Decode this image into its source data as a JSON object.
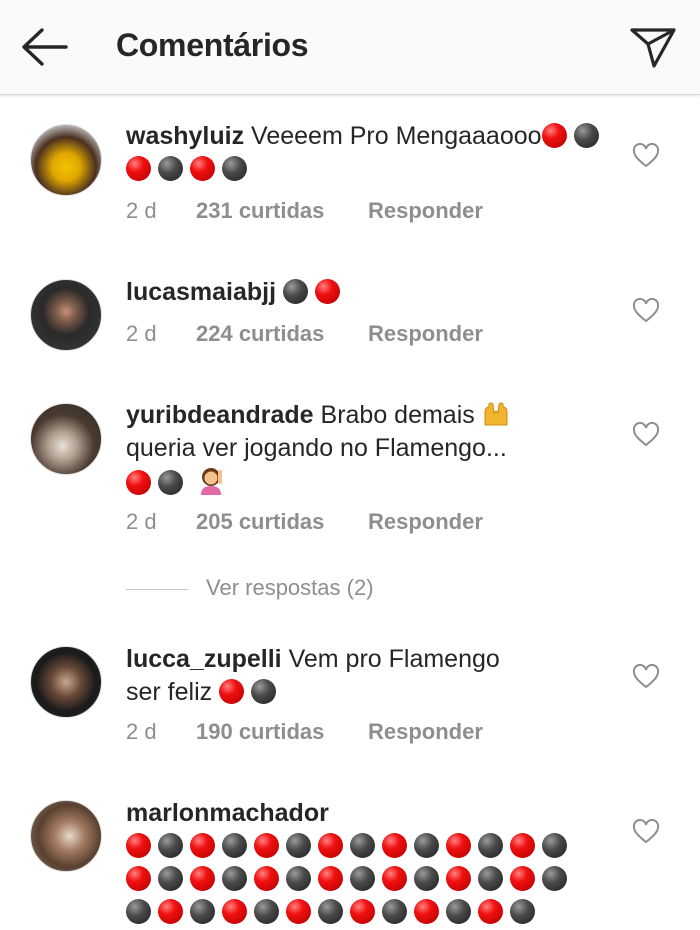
{
  "header": {
    "title": "Comentários",
    "back_icon": "arrow-left-icon",
    "send_icon": "paper-plane-icon"
  },
  "colors": {
    "text": "#262626",
    "muted": "#8e8e8e",
    "red_ball": "#e8101a",
    "black_ball": "#3a3a3a"
  },
  "comments": [
    {
      "username": "washyluiz",
      "text": "Veeeem Pro Mengaaaooo",
      "time": "2 d",
      "likes": "231 curtidas",
      "reply": "Responder"
    },
    {
      "username": "lucasmaiabjj",
      "text": "",
      "time": "2 d",
      "likes": "224 curtidas",
      "reply": "Responder"
    },
    {
      "username": "yuribdeandrade",
      "text_line1": "Brabo demais",
      "text_line2": "queria ver jogando no Flamengo...",
      "time": "2 d",
      "likes": "205 curtidas",
      "reply": "Responder",
      "view_replies": "Ver respostas (2)"
    },
    {
      "username": "lucca_zupelli",
      "text_line1": "Vem pro Flamengo",
      "text_line2": "ser feliz",
      "time": "2 d",
      "likes": "190 curtidas",
      "reply": "Responder"
    },
    {
      "username": "marlonmachador",
      "text": ""
    }
  ]
}
